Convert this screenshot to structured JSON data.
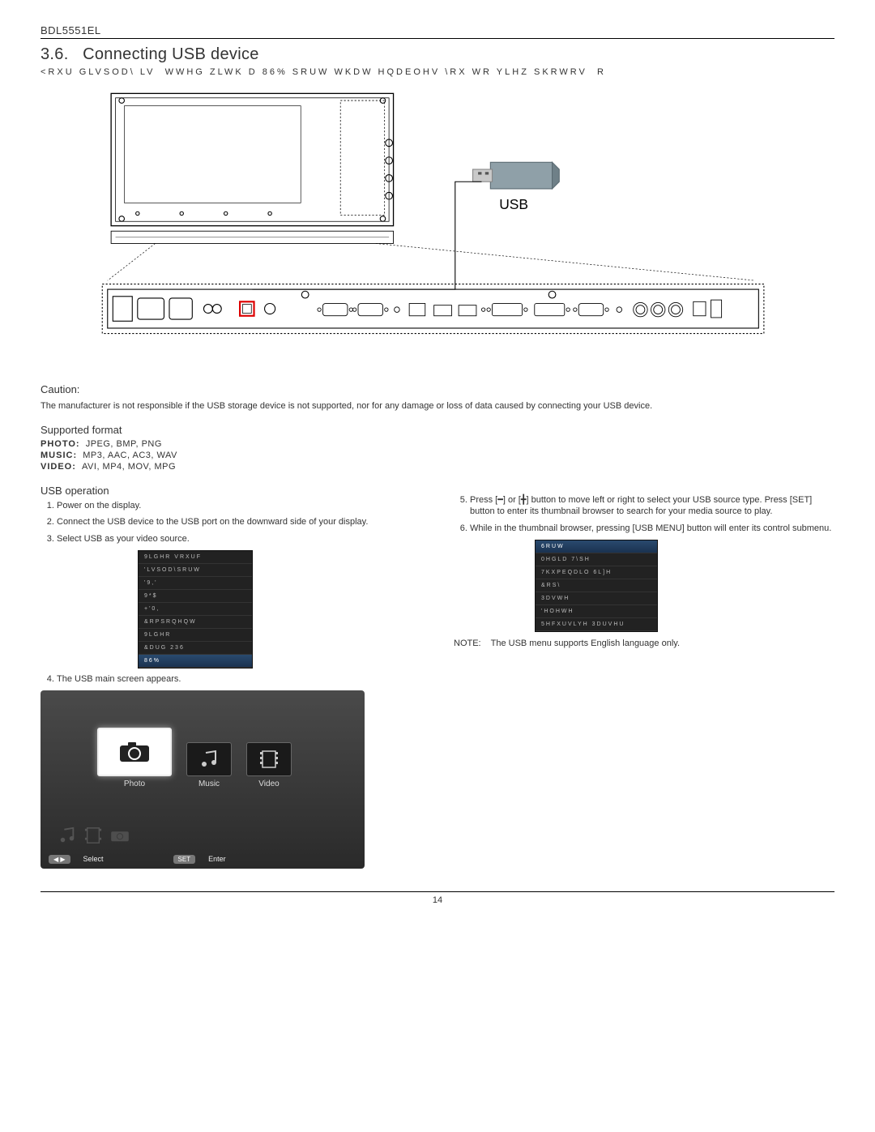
{
  "header": {
    "model": "BDL5551EL"
  },
  "section": {
    "number": "3.6.",
    "title": "Connecting USB device",
    "garbled_intro": "<RXU GLVSOD\\ LV  WWHG ZLWK D 86% SRUW WKDW HQDEOHV \\RX WR YLHZ SKRWRV  R"
  },
  "diagram": {
    "usb_label": "USB"
  },
  "caution": {
    "title": "Caution:",
    "body": "The manufacturer is not responsible if the USB storage device is not supported, nor for any damage or loss of data caused by connecting your USB device."
  },
  "supported": {
    "title": "Supported format",
    "photo_label": "PHOTO:",
    "photo_vals": "JPEG, BMP, PNG",
    "music_label": "MUSIC:",
    "music_vals": "MP3, AAC, AC3, WAV",
    "video_label": "VIDEO:",
    "video_vals": "AVI, MP4, MOV, MPG"
  },
  "usb_op": {
    "title": "USB operation",
    "steps_left": [
      "Power on the display.",
      "Connect the USB device to the USB port on the downward side of your display.",
      "Select USB as your video source.",
      "The USB main screen appears."
    ],
    "steps_right": [
      "Press [━] or [╋] button to move left or right to select your USB source type. Press [SET] button to enter its thumbnail browser to search for your media source to play.",
      "While in the thumbnail browser, pressing [USB MENU] button will enter its control submenu."
    ],
    "source_menu": [
      "9LGHR VRXUF",
      "'LVSOD\\SRUW",
      "'9,'",
      "9*$",
      "+'0,",
      "&RPSRQHQW",
      "9LGHR",
      "&DUG 236",
      "86%"
    ],
    "sort_menu": [
      "6RUW",
      "0HGLD 7\\SH",
      "7KXPEQDLO 6L]H",
      "&RS\\",
      "3DVWH",
      "'HOHWH",
      "5HFXUVLYH 3DUVHU"
    ],
    "usb_screen": {
      "photo": "Photo",
      "music": "Music",
      "video": "Video",
      "select": "Select",
      "enter": "Enter",
      "set_label": "SET"
    },
    "note_label": "NOTE:",
    "note_body": "The USB menu supports English language only."
  },
  "footer": {
    "page": "14"
  }
}
